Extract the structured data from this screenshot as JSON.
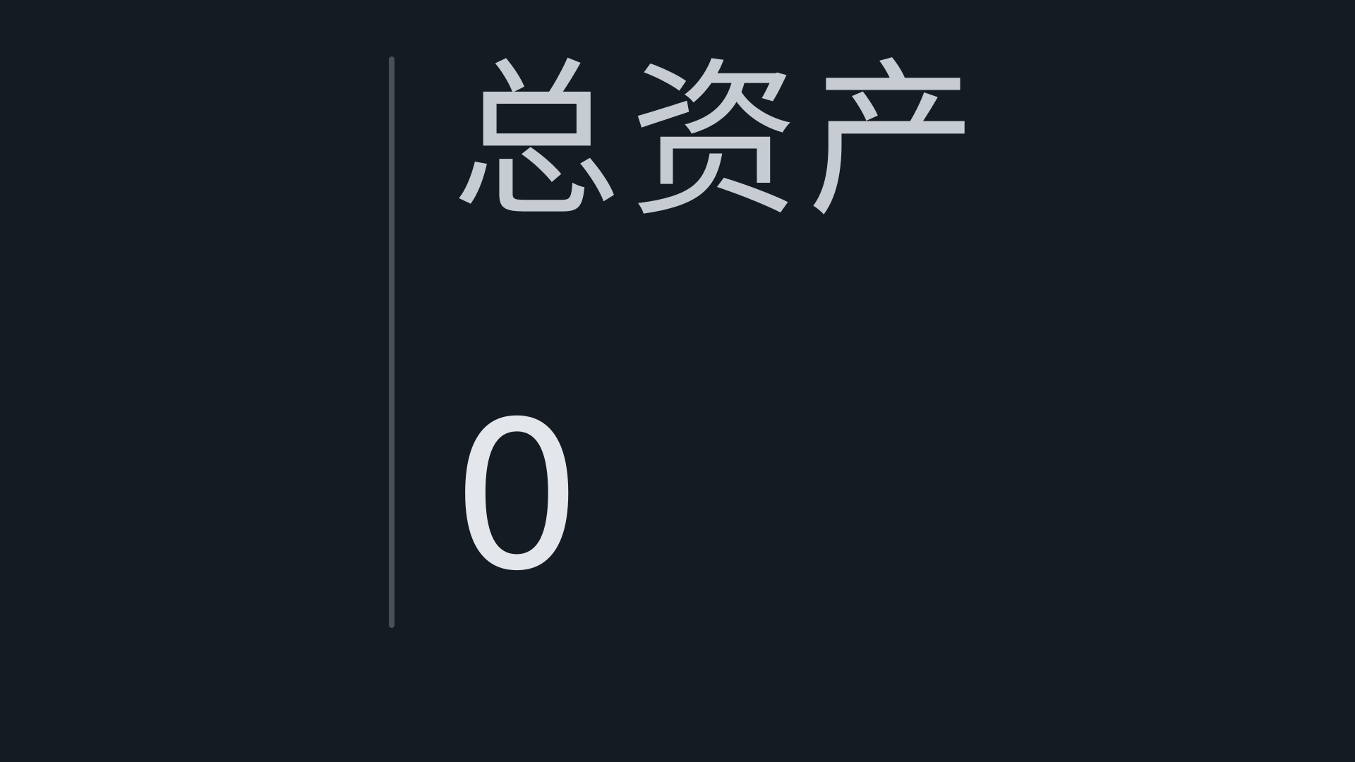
{
  "stat": {
    "label": "总资产",
    "value": "0"
  },
  "colors": {
    "background": "#151b23",
    "divider": "#4a5058",
    "label": "#c7ccd3",
    "value": "#e3e6ea"
  }
}
